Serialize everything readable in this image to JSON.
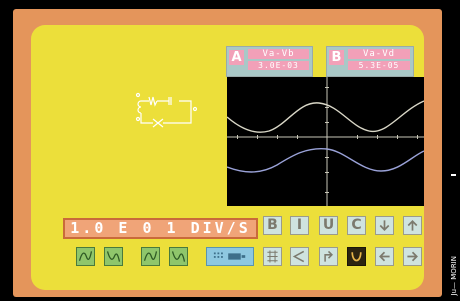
{
  "channel_a": {
    "id": "A",
    "formula": "Va-Vb",
    "scale": "3.0E-03"
  },
  "channel_b": {
    "id": "B",
    "formula": "Va-Vd",
    "scale": "5.3E-05"
  },
  "timebase": {
    "display": "1.0 E 0 1 DIV/S"
  },
  "toolbar_row1": [
    "B",
    "I",
    "U",
    "C"
  ],
  "credit": "Ju— MORIN",
  "colors": {
    "screen_bg": "#ecdf3a",
    "frame": "#e4955b",
    "trace_a": "#d9d7c7",
    "trace_b": "#9aa2d8",
    "button_green": "#8fc66b",
    "button_pale": "#cfe3df"
  },
  "icons": {
    "row1": [
      "b-icon",
      "i-icon",
      "u-icon",
      "c-icon",
      "arrow-down-icon",
      "arrow-up-icon"
    ],
    "row2_left": [
      "wave-icon",
      "wave-icon",
      "wave-icon",
      "wave-icon"
    ],
    "row2_right": [
      "image-icon",
      "grid-icon",
      "angle-icon",
      "arrow-up-right-icon",
      "u-curve-icon",
      "arrow-left-icon",
      "arrow-right-icon"
    ]
  }
}
